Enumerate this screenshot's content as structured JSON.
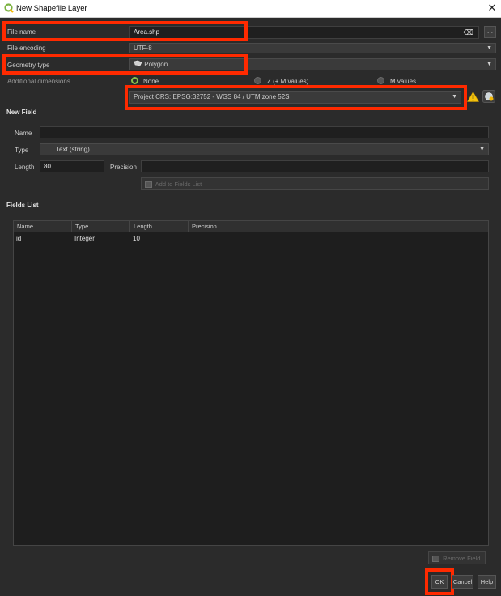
{
  "window": {
    "title": "New Shapefile Layer",
    "close_glyph": "✕"
  },
  "file_name": {
    "label": "File name",
    "value": "Area.shp",
    "clear_glyph": "⌫",
    "browse_label": "…"
  },
  "file_encoding": {
    "label": "File encoding",
    "value": "UTF-8"
  },
  "geometry_type": {
    "label": "Geometry type",
    "value": "Polygon"
  },
  "additional_dimensions": {
    "label": "Additional dimensions",
    "options": [
      {
        "label": "None",
        "selected": true
      },
      {
        "label": "Z (+ M values)",
        "selected": false
      },
      {
        "label": "M values",
        "selected": false
      }
    ]
  },
  "crs": {
    "value": "Project CRS: EPSG:32752 - WGS 84 / UTM zone 52S",
    "warning_icon": "warning-triangle-icon"
  },
  "new_field": {
    "heading": "New Field",
    "name_label": "Name",
    "name_value": "",
    "type_label": "Type",
    "type_value": "Text (string)",
    "length_label": "Length",
    "length_value": "80",
    "precision_label": "Precision",
    "precision_value": "",
    "add_button": "Add to Fields List"
  },
  "fields_list": {
    "heading": "Fields List",
    "columns": [
      "Name",
      "Type",
      "Length",
      "Precision"
    ],
    "rows": [
      {
        "name": "id",
        "type": "Integer",
        "length": "10",
        "precision": ""
      }
    ]
  },
  "buttons": {
    "remove_field": "Remove Field",
    "ok": "OK",
    "cancel": "Cancel",
    "help": "Help"
  },
  "colors": {
    "highlight": "#ff2a00",
    "background": "#2b2b2b",
    "radio_selected": "#8bc34a"
  }
}
